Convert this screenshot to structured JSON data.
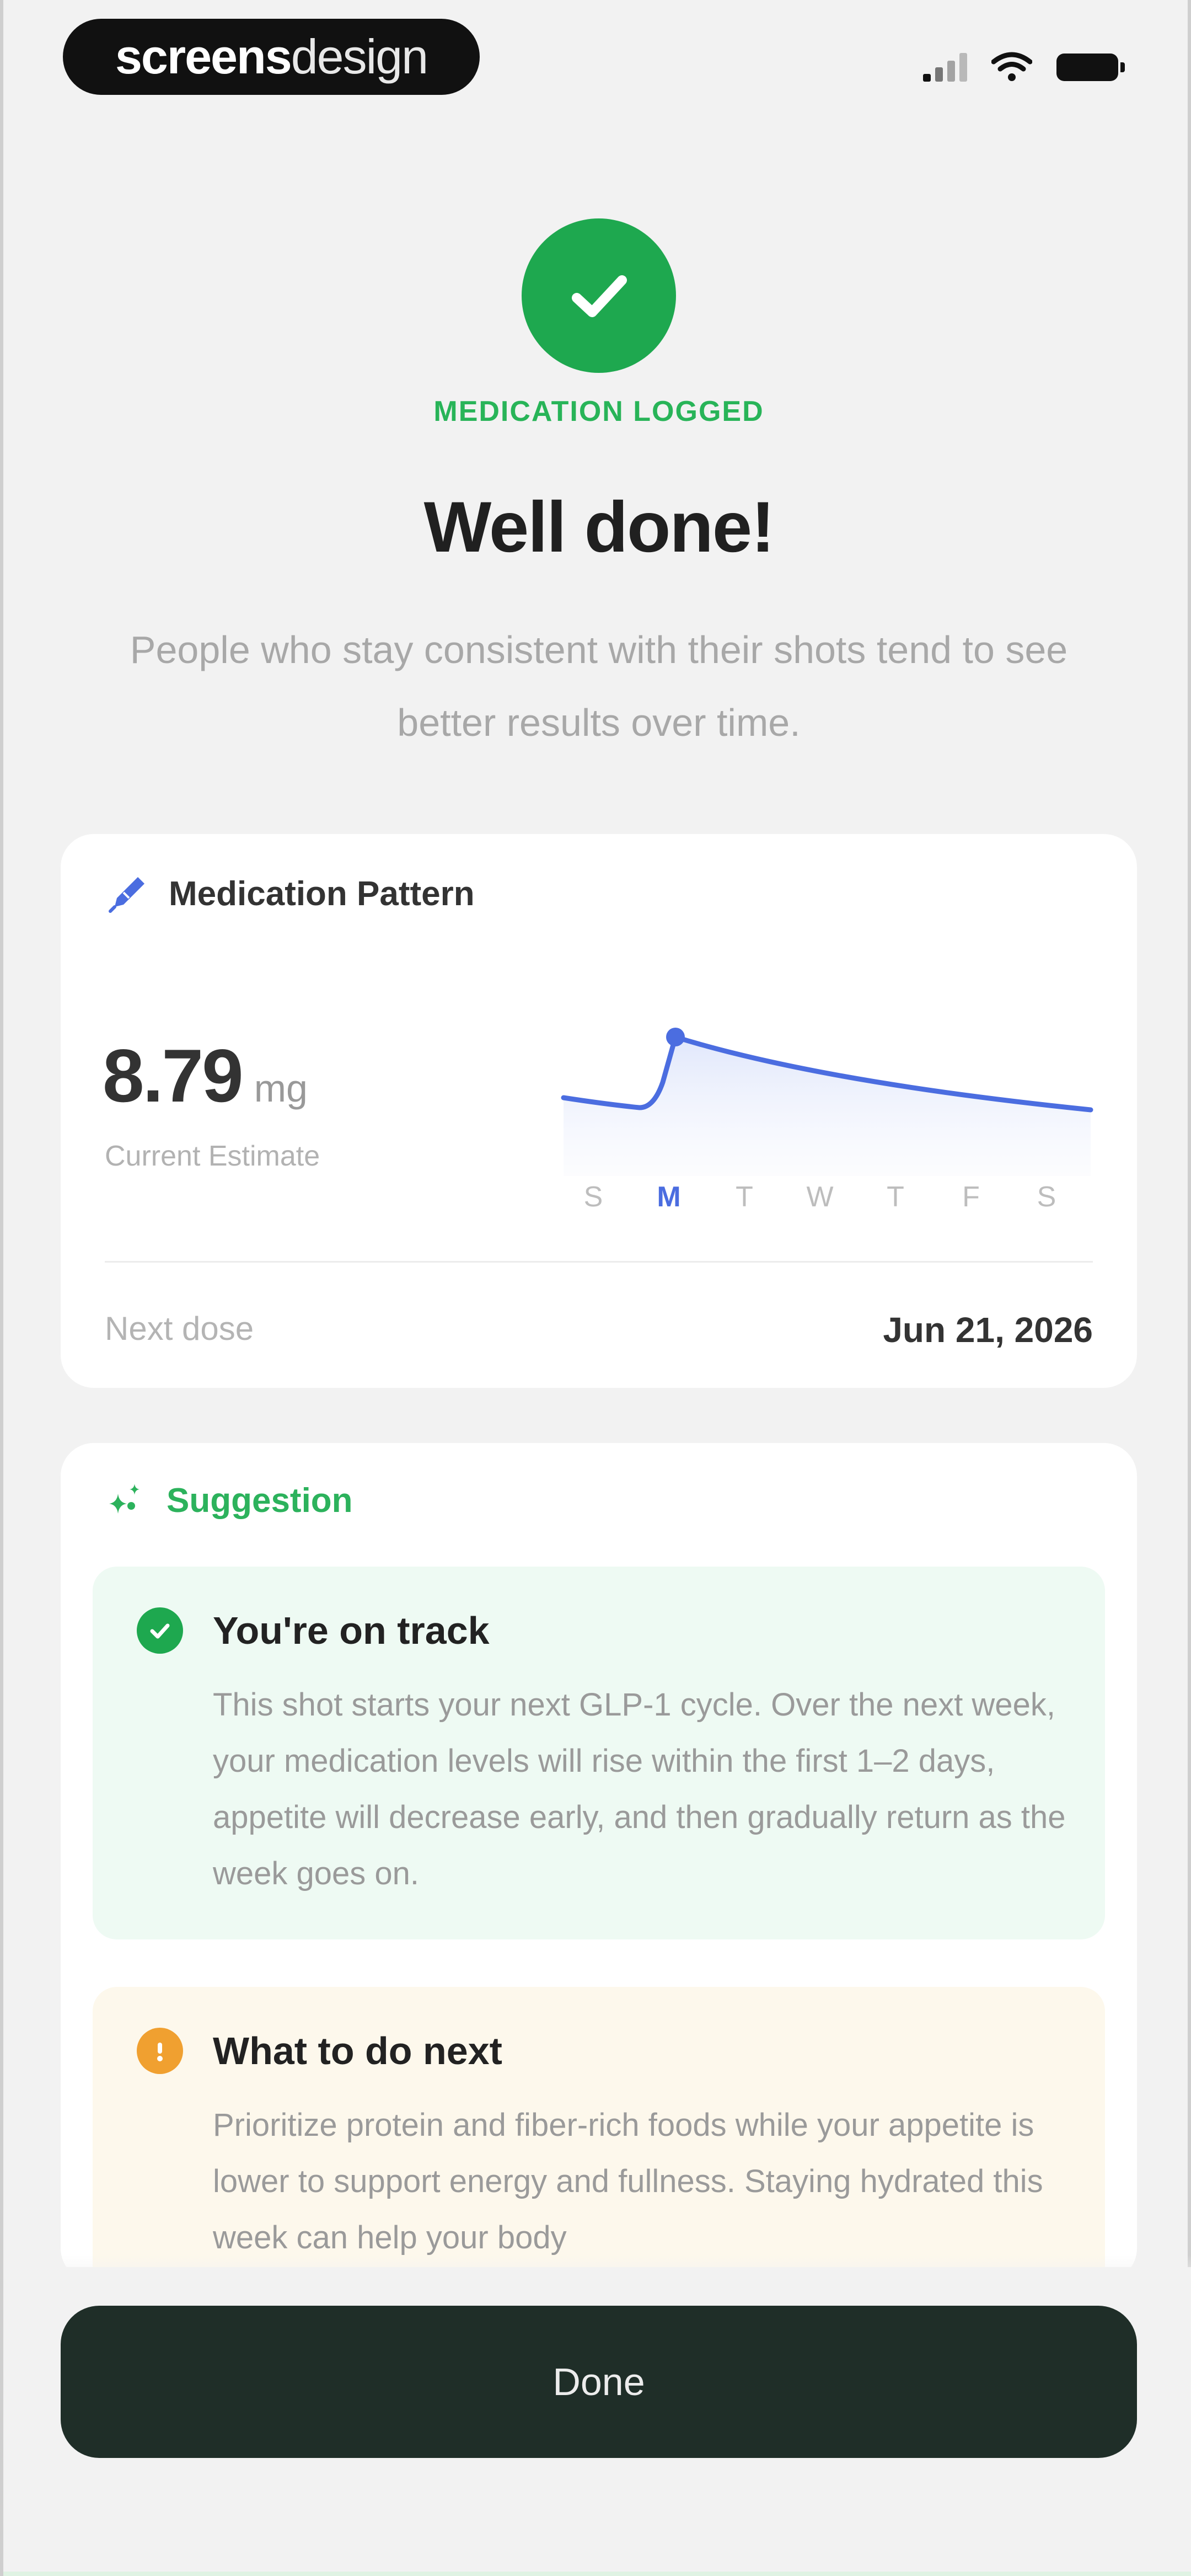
{
  "status_bar": {
    "brand_part1": "screens",
    "brand_part2": "design"
  },
  "header": {
    "status_label": "MEDICATION LOGGED",
    "title": "Well done!",
    "subtitle": "People who stay consistent with their shots tend to see better results over time."
  },
  "pattern_card": {
    "title": "Medication Pattern",
    "value": "8.79",
    "unit": "mg",
    "value_label": "Current Estimate",
    "days": [
      "S",
      "M",
      "T",
      "W",
      "T",
      "F",
      "S"
    ],
    "active_day_index": 1,
    "next_dose_label": "Next dose",
    "next_dose_date": "Jun 21, 2026",
    "colors": {
      "line": "#4b6de0",
      "fill": "#e6ecfb"
    }
  },
  "suggestion_card": {
    "title": "Suggestion",
    "on_track": {
      "title": "You're on track",
      "text": "This shot starts your next GLP-1 cycle. Over the next week, your medication levels will rise within the first 1–2 days, appetite will decrease early, and then gradually return as the week goes on."
    },
    "next_steps": {
      "title": "What to do next",
      "text": "Prioritize protein and fiber-rich foods while your appetite is lower to support energy and fullness. Staying hydrated this week can help your body"
    }
  },
  "footer": {
    "done_label": "Done"
  },
  "colors": {
    "accent_green": "#1ea84f",
    "button_dark": "#1f2e28",
    "warning_orange": "#f0a030"
  },
  "icons": {
    "status_check": "check-icon",
    "pattern": "syringe-icon",
    "suggestion": "sparkle-icon",
    "on_track": "check-circle-icon",
    "next_steps": "info-circle-icon"
  }
}
